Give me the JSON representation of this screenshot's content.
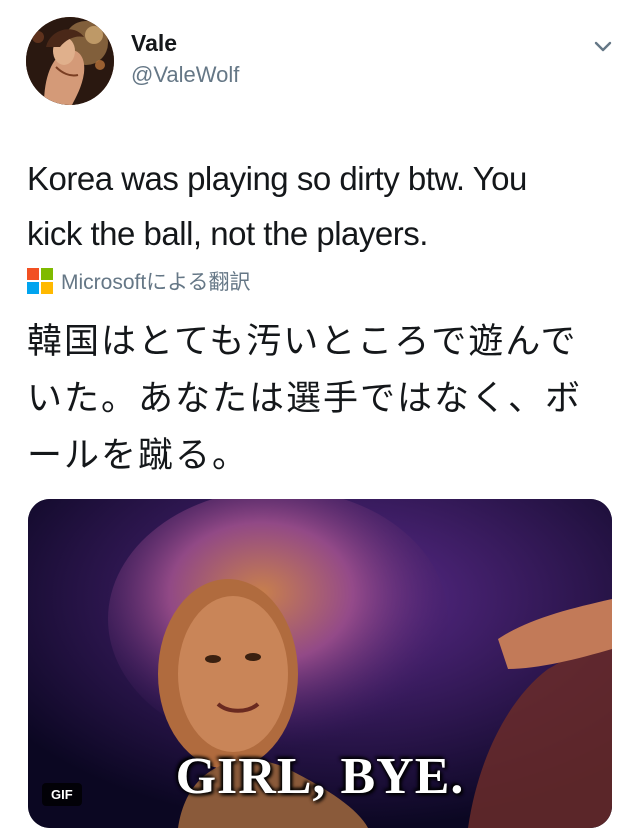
{
  "tweet": {
    "author": {
      "display_name": "Vale",
      "handle": "@ValeWolf"
    },
    "text_line1": "Korea was playing so dirty btw. You",
    "text_line2": "kick the ball, not the players.",
    "translation": {
      "attribution": "Microsoftによる翻訳",
      "line1": "韓国はとても汚いところで遊んで",
      "line2": "いた。あなたは選手ではなく、ボ",
      "line3": "ールを蹴る。"
    },
    "media": {
      "caption": "GIRL, BYE.",
      "badge": "GIF"
    }
  },
  "colors": {
    "text_primary": "#14171a",
    "text_secondary": "#657786",
    "ms_red": "#f25022",
    "ms_green": "#7fba00",
    "ms_blue": "#00a4ef",
    "ms_yellow": "#ffb900"
  },
  "icons": {
    "menu": "chevron-down-icon",
    "translator": "microsoft-logo-icon"
  }
}
